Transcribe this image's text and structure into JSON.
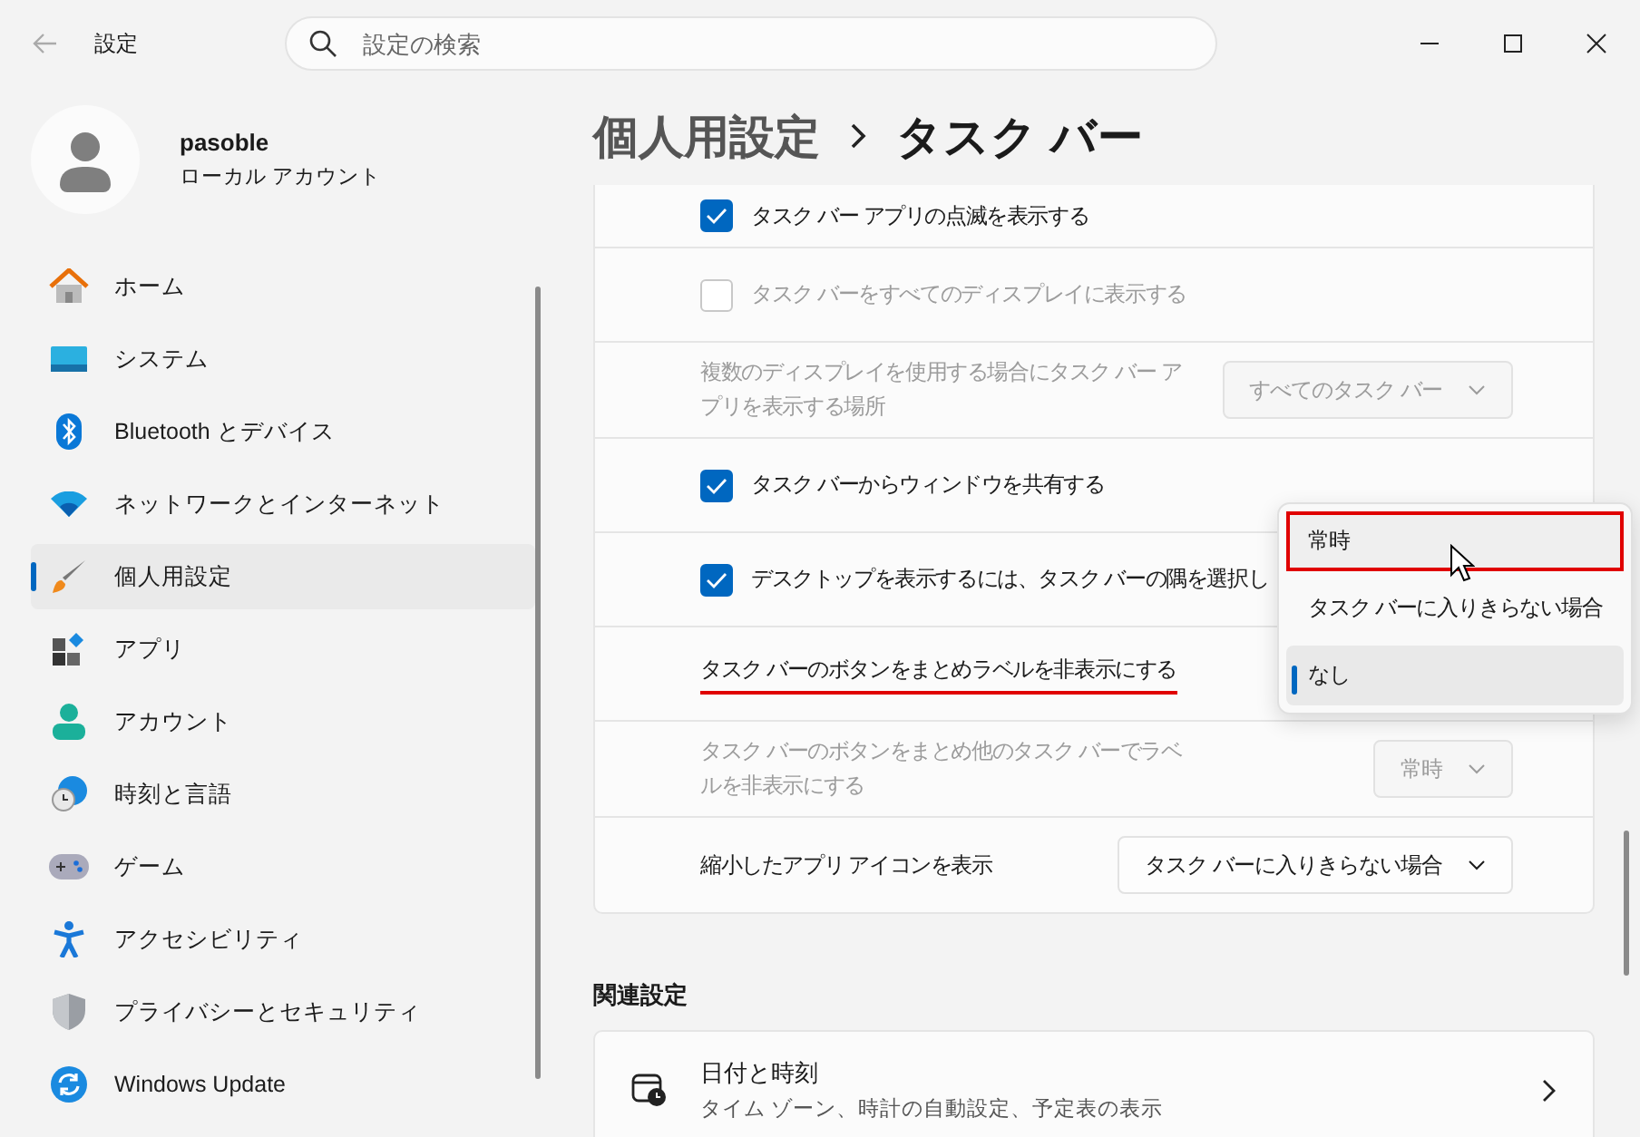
{
  "window": {
    "title": "設定"
  },
  "search": {
    "placeholder": "設定の検索"
  },
  "account": {
    "name": "pasoble",
    "type": "ローカル アカウント"
  },
  "nav": [
    {
      "label": "ホーム",
      "selected": false
    },
    {
      "label": "システム",
      "selected": false
    },
    {
      "label": "Bluetooth とデバイス",
      "selected": false
    },
    {
      "label": "ネットワークとインターネット",
      "selected": false
    },
    {
      "label": "個人用設定",
      "selected": true
    },
    {
      "label": "アプリ",
      "selected": false
    },
    {
      "label": "アカウント",
      "selected": false
    },
    {
      "label": "時刻と言語",
      "selected": false
    },
    {
      "label": "ゲーム",
      "selected": false
    },
    {
      "label": "アクセシビリティ",
      "selected": false
    },
    {
      "label": "プライバシーとセキュリティ",
      "selected": false
    },
    {
      "label": "Windows Update",
      "selected": false
    }
  ],
  "breadcrumb": [
    "個人用設定",
    "タスク バー"
  ],
  "settings": [
    {
      "kind": "checkbox",
      "label": "タスク バー アプリの点滅を表示する",
      "checked": true,
      "disabled": false
    },
    {
      "kind": "checkbox",
      "label": "タスク バーをすべてのディスプレイに表示する",
      "checked": false,
      "disabled": true
    },
    {
      "kind": "dropdown",
      "label": "複数のディスプレイを使用する場合にタスク バー アプリを表示する場所",
      "value": "すべてのタスク バー",
      "disabled": true
    },
    {
      "kind": "checkbox",
      "label": "タスク バーからウィンドウを共有する",
      "checked": true,
      "disabled": false
    },
    {
      "kind": "checkbox",
      "label": "デスクトップを表示するには、タスク バーの隅を選択し",
      "checked": true,
      "disabled": false
    },
    {
      "kind": "menu",
      "label": "タスク バーのボタンをまとめラベルを非表示にする",
      "underlined": true,
      "options": [
        {
          "label": "常時",
          "selected": false,
          "highlighted": true
        },
        {
          "label": "タスク バーに入りきらない場合",
          "selected": false,
          "highlighted": false
        },
        {
          "label": "なし",
          "selected": true,
          "highlighted": false
        }
      ]
    },
    {
      "kind": "dropdown",
      "label": "タスク バーのボタンをまとめ他のタスク バーでラベルを非表示にする",
      "value": "常時",
      "disabled": true
    },
    {
      "kind": "dropdown",
      "label": "縮小したアプリ アイコンを表示",
      "value": "タスク バーに入りきらない場合",
      "disabled": false
    }
  ],
  "related": {
    "heading": "関連設定",
    "items": [
      {
        "title": "日付と時刻",
        "subtitle": "タイム ゾーン、時計の自動設定、予定表の表示"
      }
    ]
  }
}
